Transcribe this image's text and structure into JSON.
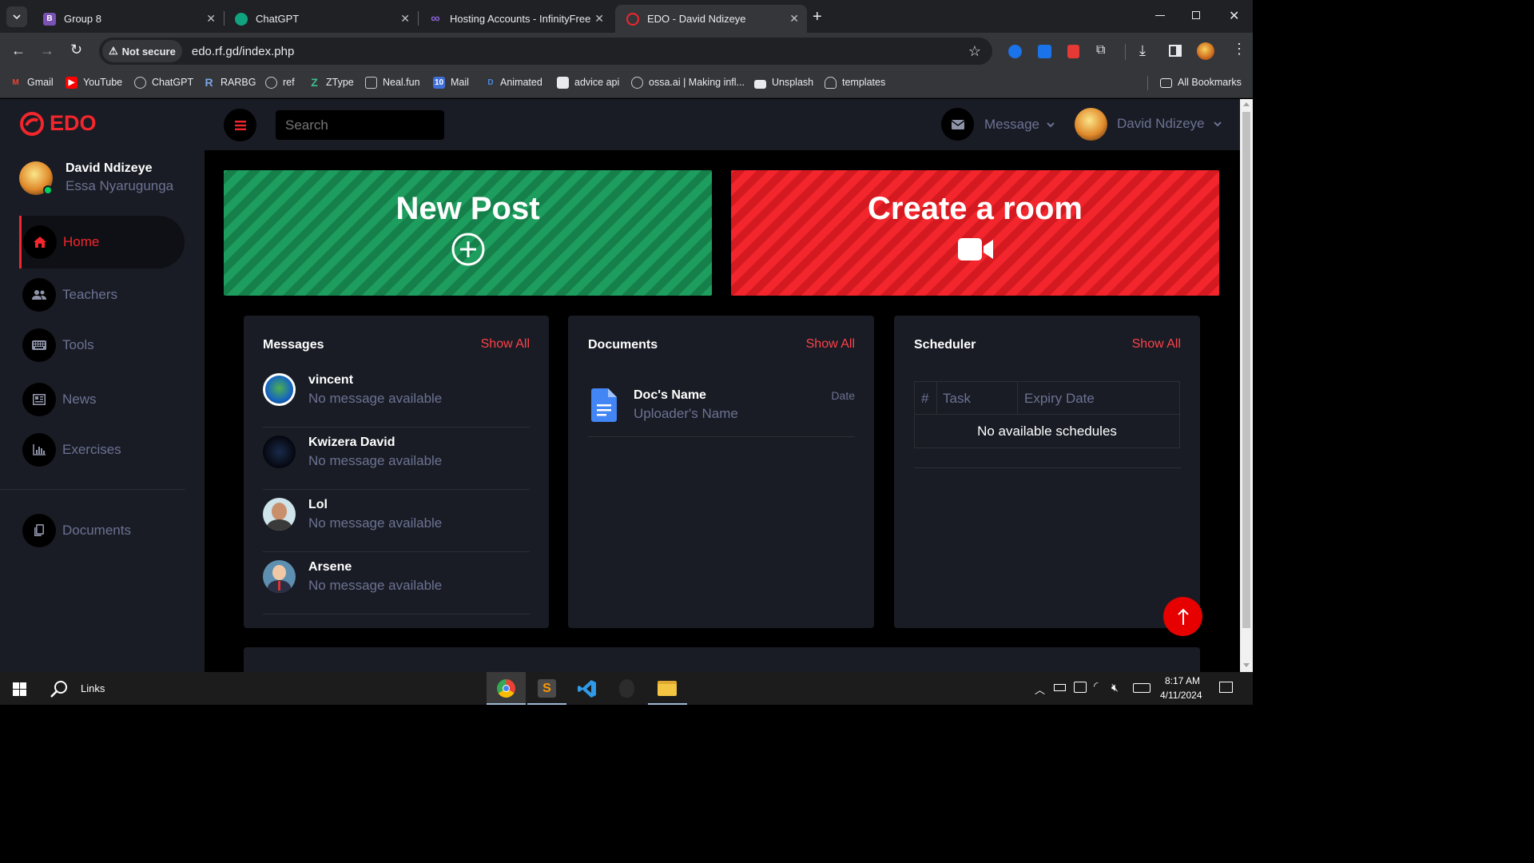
{
  "browser": {
    "tabs": [
      {
        "title": "Group 8",
        "favicon": "B"
      },
      {
        "title": "ChatGPT",
        "favicon": "chatgpt-icon"
      },
      {
        "title": "Hosting Accounts - InfinityFree",
        "favicon": "∞"
      },
      {
        "title": "EDO - David Ndizeye",
        "favicon": "edo-icon",
        "active": true
      }
    ],
    "security_label": "Not secure",
    "url": "edo.rf.gd/index.php",
    "bookmarks": [
      "Gmail",
      "YouTube",
      "ChatGPT",
      "RARBG",
      "ref",
      "ZType",
      "Neal.fun",
      "Mail",
      "Animated",
      "advice api",
      "ossa.ai | Making infl...",
      "Unsplash",
      "templates"
    ],
    "all_bookmarks": "All Bookmarks"
  },
  "app": {
    "brand": "EDO",
    "search_placeholder": "Search",
    "header": {
      "message_label": "Message",
      "user_name": "David Ndizeye"
    },
    "profile": {
      "name": "David Ndizeye",
      "subtitle": "Essa Nyarugunga"
    },
    "nav": [
      {
        "label": "Home",
        "icon": "home-icon",
        "active": true
      },
      {
        "label": "Teachers",
        "icon": "users-icon"
      },
      {
        "label": "Tools",
        "icon": "keyboard-icon"
      },
      {
        "label": "News",
        "icon": "newspaper-icon"
      },
      {
        "label": "Exercises",
        "icon": "chart-bar-icon"
      },
      {
        "label": "Documents",
        "icon": "copy-icon"
      }
    ],
    "banners": {
      "new_post": "New Post",
      "create_room": "Create a room"
    },
    "messages": {
      "title": "Messages",
      "show_all": "Show All",
      "items": [
        {
          "name": "vincent",
          "text": "No message available"
        },
        {
          "name": "Kwizera David",
          "text": "No message available"
        },
        {
          "name": "Lol",
          "text": "No message available"
        },
        {
          "name": "Arsene",
          "text": "No message available"
        }
      ]
    },
    "documents": {
      "title": "Documents",
      "show_all": "Show All",
      "items": [
        {
          "name": "Doc's Name",
          "uploader": "Uploader's Name",
          "date": "Date"
        }
      ]
    },
    "scheduler": {
      "title": "Scheduler",
      "show_all": "Show All",
      "columns": [
        "#",
        "Task",
        "Expiry Date"
      ],
      "empty": "No available schedules"
    }
  },
  "taskbar": {
    "search_label": "Links",
    "time": "8:17 AM",
    "date": "4/11/2024"
  },
  "colors": {
    "accent": "#fc424a",
    "green": "#1e9e5e",
    "red": "#f2262c",
    "sidebar": "#191c24"
  }
}
